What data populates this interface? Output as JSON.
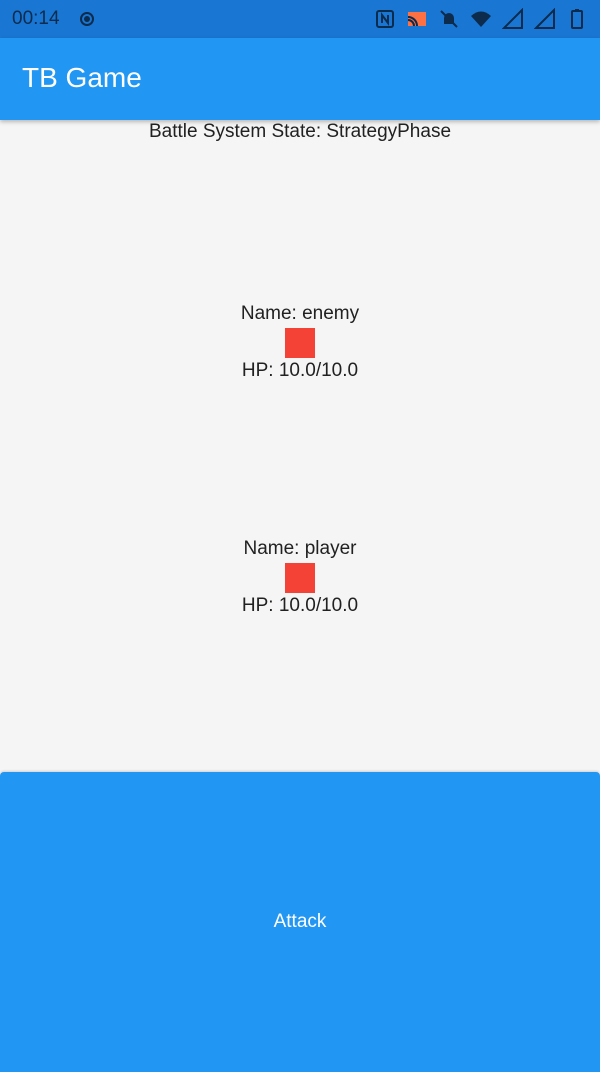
{
  "status_bar": {
    "time": "00:14",
    "icons": [
      "record-icon",
      "nfc-icon",
      "cast-icon",
      "notifications-off-icon",
      "wifi-icon",
      "signal-icon",
      "signal-icon",
      "battery-icon"
    ]
  },
  "app_bar": {
    "title": "TB Game",
    "color": "#2196f3"
  },
  "battle": {
    "state_text": "Battle System State: StrategyPhase",
    "enemy": {
      "name_text": "Name: enemy",
      "hp_text": "HP: 10.0/10.0",
      "sprite_color": "#f44336"
    },
    "player": {
      "name_text": "Name: player",
      "hp_text": "HP: 10.0/10.0",
      "sprite_color": "#f44336"
    }
  },
  "actions": {
    "attack_label": "Attack"
  }
}
